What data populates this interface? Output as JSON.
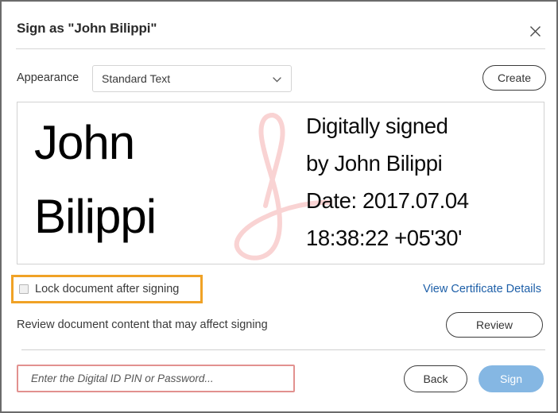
{
  "dialog": {
    "title": "Sign as \"John Bilippi\"",
    "close_icon": "close-icon"
  },
  "appearance": {
    "label": "Appearance",
    "selected": "Standard Text",
    "options": [
      "Standard Text"
    ],
    "chevron_icon": "chevron-down-icon",
    "create_label": "Create"
  },
  "signature_preview": {
    "watermark_icon": "acrobat-a-icon",
    "watermark_color": "#f9d6d6",
    "name_lines": [
      "John",
      "Bilippi"
    ],
    "detail_lines": [
      "Digitally signed",
      "by John Bilippi",
      "Date: 2017.07.04",
      "18:38:22 +05'30'"
    ]
  },
  "lock_row": {
    "checkbox_label": "Lock document after signing",
    "checked": false,
    "highlight_color": "#f0a226",
    "certificate_link": "View Certificate Details",
    "link_color": "#1d5fa8"
  },
  "review_row": {
    "text": "Review document content that may affect signing",
    "button_label": "Review"
  },
  "footer": {
    "pin_placeholder": "Enter the Digital ID PIN or Password...",
    "pin_value": "",
    "pin_border_color": "#e2918f",
    "back_label": "Back",
    "sign_label": "Sign",
    "sign_button_color": "#85b7e3"
  }
}
